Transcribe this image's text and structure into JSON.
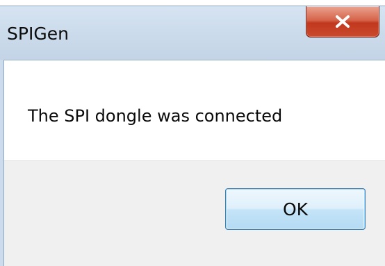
{
  "dialog": {
    "title": "SPIGen",
    "message": "The SPI dongle was connected",
    "ok_label": "OK",
    "close_glyph": "x",
    "close_icon": "close-icon"
  },
  "colors": {
    "titlebar": "#cddcec",
    "close_button": "#c94a2e",
    "button_area": "#f0f0f0",
    "ok_button_border": "#3c7fb1"
  }
}
